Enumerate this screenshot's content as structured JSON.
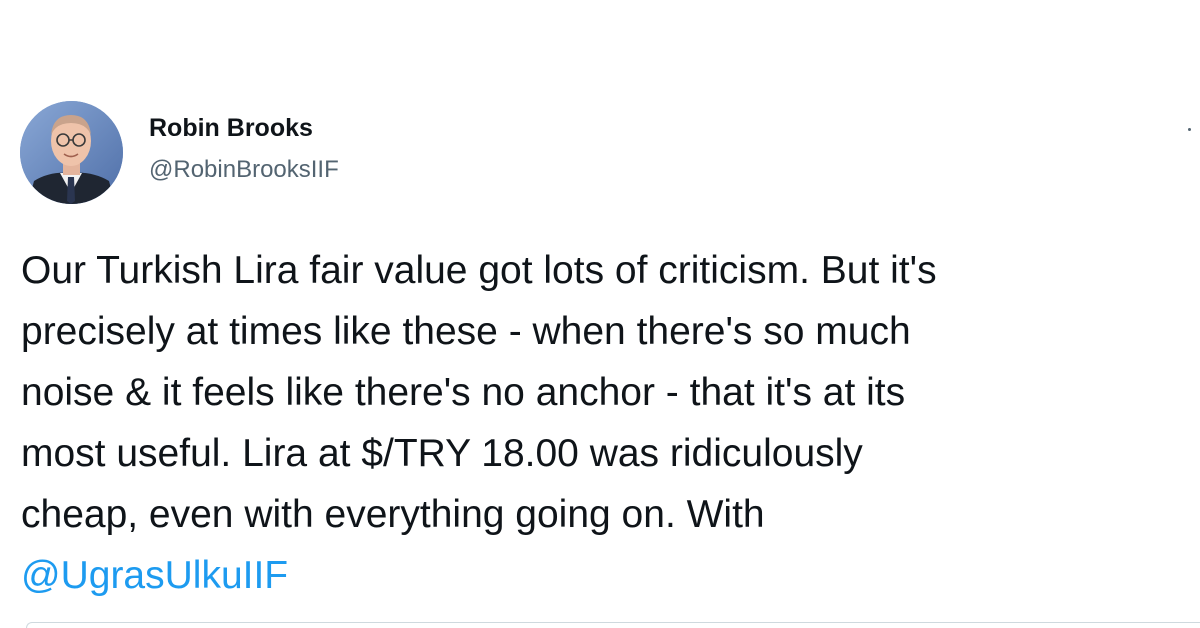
{
  "author": {
    "name": "Robin Brooks",
    "handle": "@RobinBrooksIIF"
  },
  "tweet": {
    "lines": [
      "Our Turkish Lira fair value got lots of criticism. But it's",
      "precisely at times like these - when there's so much",
      "noise & it feels like there's no anchor - that it's at its",
      "most useful. Lira at $/TRY 18.00 was ridiculously",
      "cheap, even with everything going on. With"
    ],
    "mention": "@UgrasUlkuIIF"
  },
  "icons": {
    "avatar": "profile-photo",
    "more": "more-options-icon"
  },
  "colors": {
    "text": "#0f1419",
    "secondary": "#536471",
    "link": "#1d9bf0",
    "border": "#cfd9de"
  }
}
